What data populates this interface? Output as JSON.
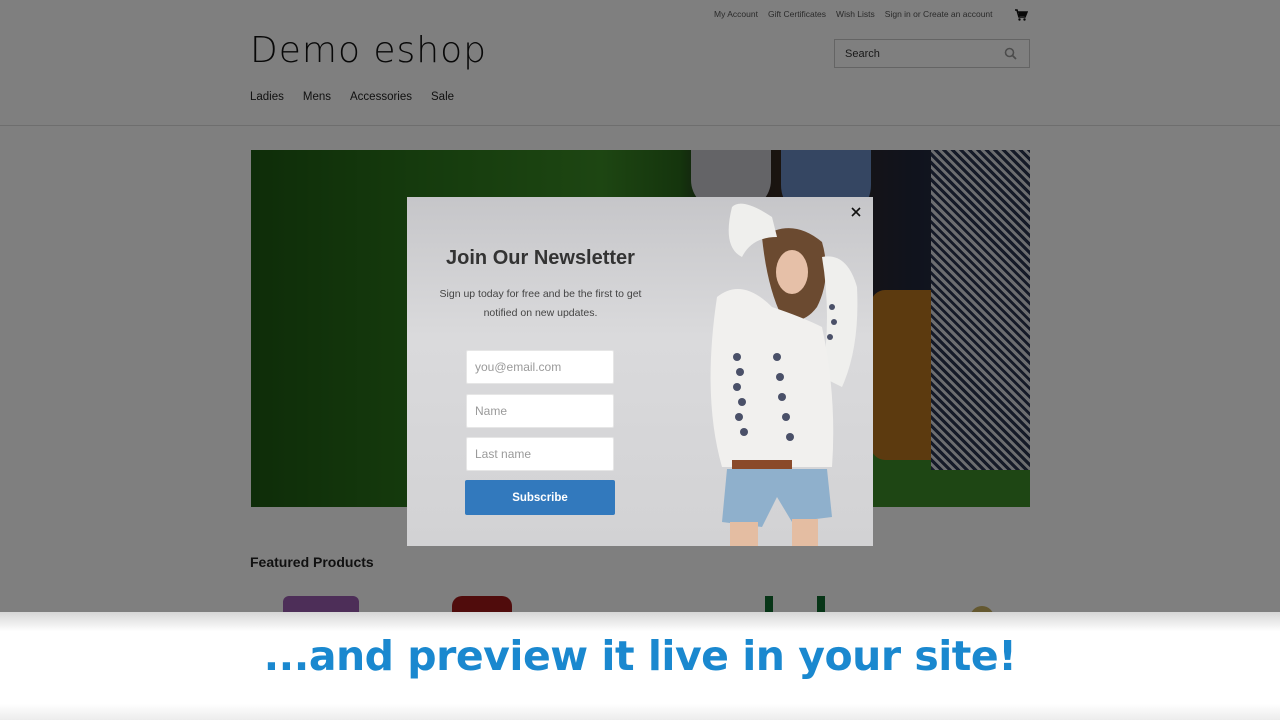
{
  "header": {
    "top_links": [
      "My Account",
      "Gift Certificates",
      "Wish Lists",
      "Sign in or Create an account"
    ],
    "cart_icon": "shopping-cart-icon",
    "logo": "Demo eshop",
    "search": {
      "placeholder": "Search",
      "icon": "search-icon"
    },
    "nav": [
      "Ladies",
      "Mens",
      "Accessories",
      "Sale"
    ]
  },
  "hero": {
    "image": "grass-suitcase-menswear-banner"
  },
  "featured": {
    "title": "Featured Products"
  },
  "popup": {
    "title": "Join Our Newsletter",
    "description": "Sign up today for free and be the first to get notified on new updates.",
    "fields": {
      "email_placeholder": "you@email.com",
      "name_placeholder": "Name",
      "last_name_placeholder": "Last name"
    },
    "subscribe_label": "Subscribe",
    "close_icon": "close-icon",
    "image": "woman-embroidered-blouse-photo",
    "colors": {
      "button": "#3279bd"
    }
  },
  "banner": {
    "caption": "...and preview it live in your site!",
    "color": "#1a88cf"
  }
}
